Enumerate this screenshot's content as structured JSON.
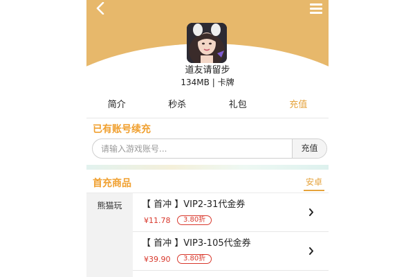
{
  "app": {
    "name": "道友请留步",
    "meta": "134MB | 卡牌"
  },
  "header": {
    "back_icon": "back-chevron-icon",
    "menu_icon": "hamburger-menu-icon"
  },
  "tabs": [
    {
      "label": "简介",
      "active": false
    },
    {
      "label": "秒杀",
      "active": false
    },
    {
      "label": "礼包",
      "active": false
    },
    {
      "label": "充值",
      "active": true
    }
  ],
  "recharge": {
    "title": "已有账号续充",
    "input_placeholder": "请输入游戏账号...",
    "button_label": "充值"
  },
  "goods": {
    "title": "首充商品",
    "platform_tab": "安卓",
    "nav_items": [
      "熊猫玩"
    ],
    "items": [
      {
        "name": "【 首冲 】VIP2-31代金券",
        "price": "¥11.78",
        "discount": "3.80折"
      },
      {
        "name": "【 首冲 】VIP3-105代金券",
        "price": "¥39.90",
        "discount": "3.80折"
      }
    ]
  },
  "colors": {
    "header_bg": "#E7B86B",
    "accent": "#F0A030",
    "price_red": "#D8372B"
  }
}
